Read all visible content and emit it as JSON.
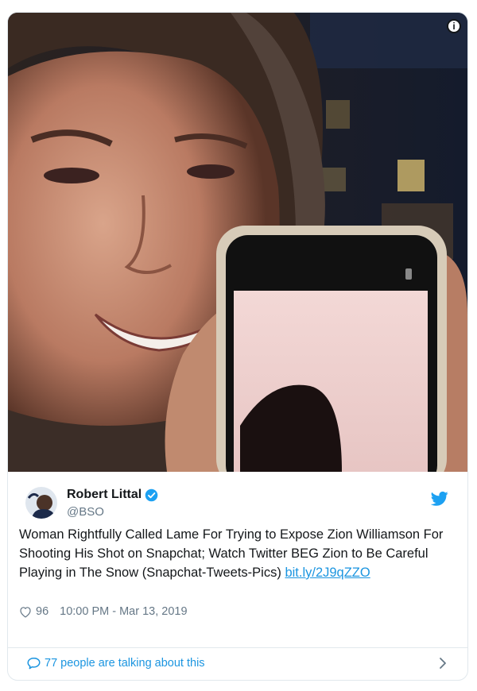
{
  "tweet": {
    "author_name": "Robert Littal",
    "author_handle": "@BSO",
    "text_main": "Woman Rightfully Called Lame For Trying to Expose Zion Williamson For Shooting His Shot on Snapchat; Watch Twitter BEG Zion to Be Careful Playing in The Snow (Snapchat-Tweets-Pics) ",
    "link_text": "bit.ly/2J9qZZO",
    "likes": "96",
    "timestamp": "10:00 PM - Mar 13, 2019",
    "footer_text": "77 people are talking about this",
    "info_label": "i"
  },
  "colors": {
    "link": "#1b95e0",
    "secondary_text": "#657786",
    "border": "#e1e8ed",
    "verified": "#1da1f2"
  },
  "icons": [
    "info-icon",
    "verified-badge-icon",
    "twitter-bird-icon",
    "heart-icon",
    "speech-bubble-icon",
    "chevron-right-icon"
  ]
}
